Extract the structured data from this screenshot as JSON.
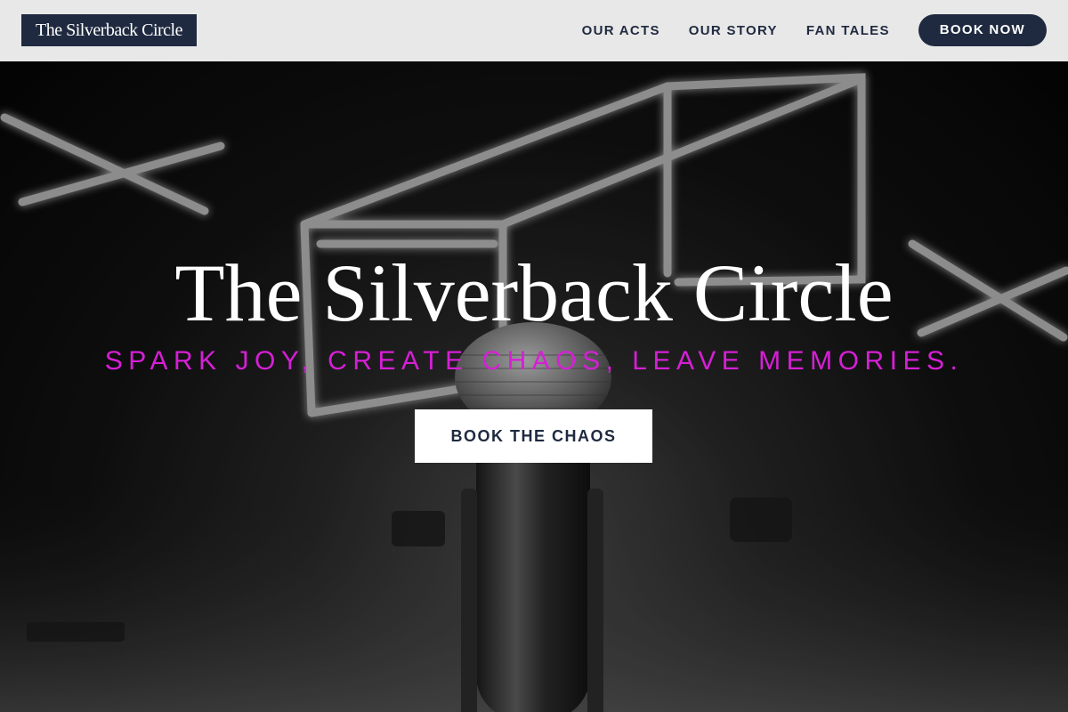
{
  "brand": {
    "name": "The Silverback Circle"
  },
  "nav": {
    "links": [
      {
        "label": "OUR ACTS"
      },
      {
        "label": "OUR STORY"
      },
      {
        "label": "FAN TALES"
      }
    ],
    "cta_label": "BOOK NOW"
  },
  "hero": {
    "title": "The Silverback Circle",
    "tagline": "SPARK JOY, CREATE CHAOS, LEAVE MEMORIES.",
    "button_label": "BOOK THE CHAOS",
    "background_image": "neon-stage-microphone-photo"
  },
  "colors": {
    "navy": "#1f2a40",
    "nav_bg": "#e8e8e8",
    "tagline_magenta": "#d61fd6",
    "white": "#ffffff"
  }
}
